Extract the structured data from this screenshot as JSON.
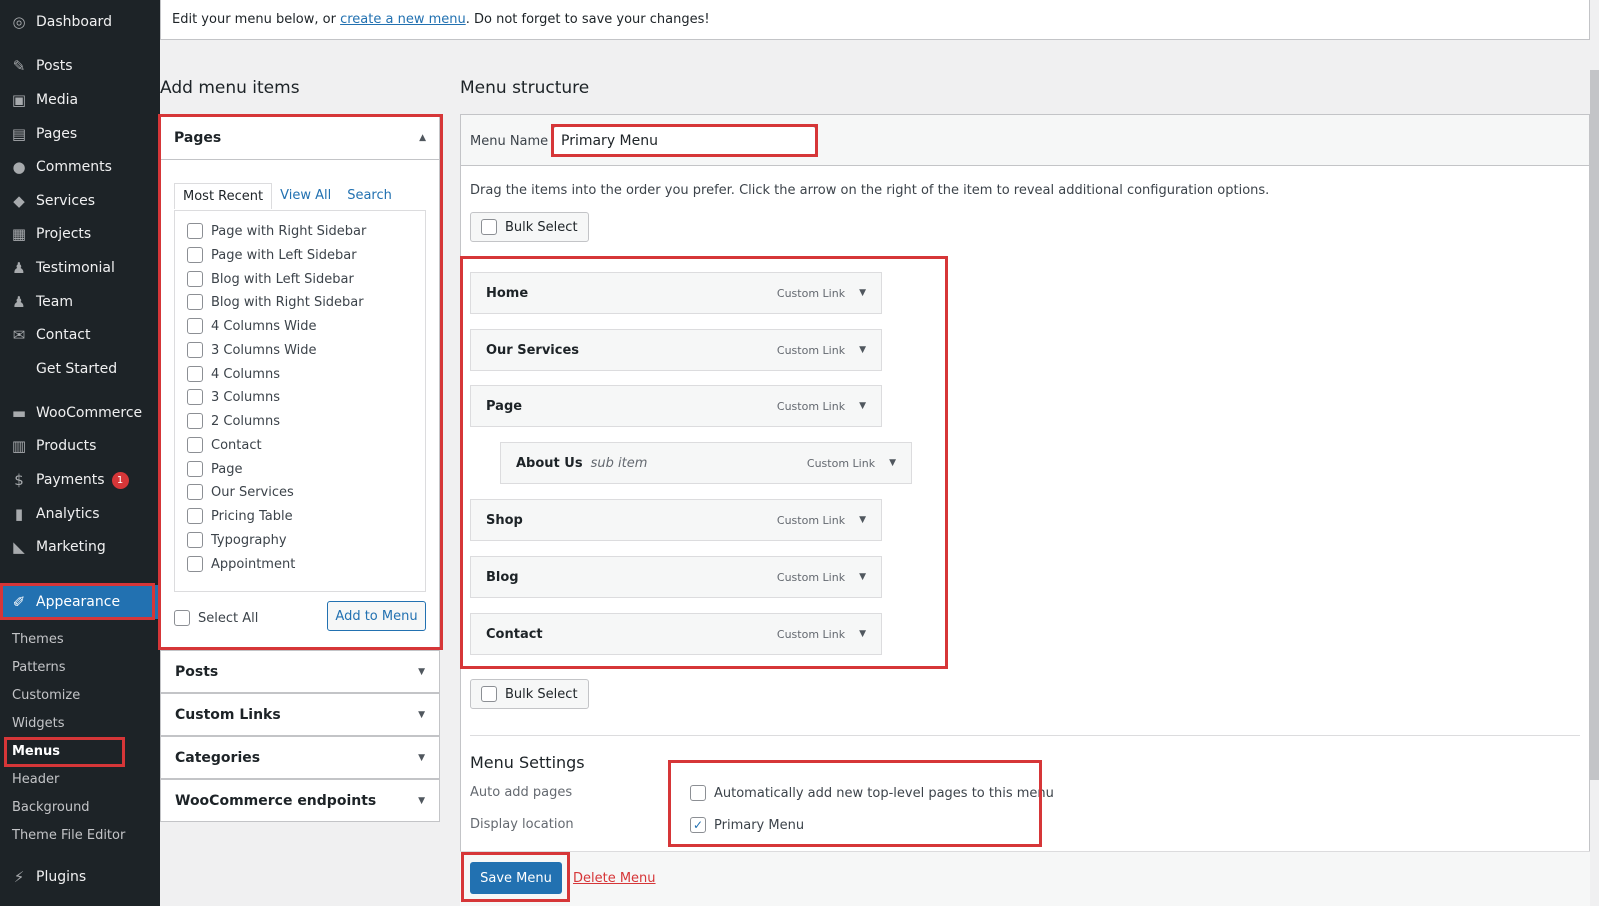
{
  "sidebar": {
    "items": [
      {
        "label": "Dashboard",
        "icon": "dashboard-icon",
        "glyph": "◎"
      },
      {
        "label": "Posts",
        "icon": "pin-icon",
        "glyph": "✎"
      },
      {
        "label": "Media",
        "icon": "media-icon",
        "glyph": "▣"
      },
      {
        "label": "Pages",
        "icon": "pages-icon",
        "glyph": "▤"
      },
      {
        "label": "Comments",
        "icon": "comment-icon",
        "glyph": "●"
      },
      {
        "label": "Services",
        "icon": "tag-icon",
        "glyph": "◆"
      },
      {
        "label": "Projects",
        "icon": "portfolio-icon",
        "glyph": "▦"
      },
      {
        "label": "Testimonial",
        "icon": "person-icon",
        "glyph": "♟"
      },
      {
        "label": "Team",
        "icon": "person-icon",
        "glyph": "♟"
      },
      {
        "label": "Contact",
        "icon": "mail-icon",
        "glyph": "✉"
      },
      {
        "label": "Get Started",
        "icon": "",
        "glyph": ""
      },
      {
        "label": "WooCommerce",
        "icon": "woo-icon",
        "glyph": "▬"
      },
      {
        "label": "Products",
        "icon": "archive-icon",
        "glyph": "▥"
      },
      {
        "label": "Payments",
        "icon": "payment-icon",
        "glyph": "$"
      },
      {
        "label": "Analytics",
        "icon": "chart-bar-icon",
        "glyph": "▮"
      },
      {
        "label": "Marketing",
        "icon": "megaphone-icon",
        "glyph": "◣"
      },
      {
        "label": "Appearance",
        "icon": "paintbrush-icon",
        "glyph": "✐"
      },
      {
        "label": "Plugins",
        "icon": "plugin-icon",
        "glyph": "⚡"
      }
    ],
    "payments_badge": "1",
    "appearance_sub": [
      "Themes",
      "Patterns",
      "Customize",
      "Widgets",
      "Menus",
      "Header",
      "Background",
      "Theme File Editor"
    ]
  },
  "notice": {
    "before": "Edit your menu below, or ",
    "link": "create a new menu",
    "after": ". Do not forget to save your changes!"
  },
  "add_items": {
    "title": "Add menu items",
    "pages_label": "Pages",
    "tabs": [
      "Most Recent",
      "View All",
      "Search"
    ],
    "pages": [
      "Page with Right Sidebar",
      "Page with Left Sidebar",
      "Blog with Left Sidebar",
      "Blog with Right Sidebar",
      "4 Columns Wide",
      "3 Columns Wide",
      "4 Columns",
      "3 Columns",
      "2 Columns",
      "Contact",
      "Page",
      "Our Services",
      "Pricing Table",
      "Typography",
      "Appointment"
    ],
    "select_all": "Select All",
    "add_button": "Add to Menu",
    "sections": [
      "Posts",
      "Custom Links",
      "Categories",
      "WooCommerce endpoints"
    ]
  },
  "structure": {
    "title": "Menu structure",
    "menu_name_label": "Menu Name",
    "menu_name_value": "Primary Menu",
    "instructions": "Drag the items into the order you prefer. Click the arrow on the right of the item to reveal additional configuration options.",
    "bulk_select": "Bulk Select",
    "items": [
      {
        "label": "Home",
        "type": "Custom Link",
        "sub": ""
      },
      {
        "label": "Our Services",
        "type": "Custom Link",
        "sub": ""
      },
      {
        "label": "Page",
        "type": "Custom Link",
        "sub": ""
      },
      {
        "label": "About Us",
        "type": "Custom Link",
        "sub": "sub item"
      },
      {
        "label": "Shop",
        "type": "Custom Link",
        "sub": ""
      },
      {
        "label": "Blog",
        "type": "Custom Link",
        "sub": ""
      },
      {
        "label": "Contact",
        "type": "Custom Link",
        "sub": ""
      }
    ]
  },
  "settings": {
    "title": "Menu Settings",
    "auto_add_label": "Auto add pages",
    "auto_add_option": "Automatically add new top-level pages to this menu",
    "display_label": "Display location",
    "display_option": "Primary Menu",
    "display_checked": "✓"
  },
  "actions": {
    "save": "Save Menu",
    "delete": "Delete Menu"
  }
}
